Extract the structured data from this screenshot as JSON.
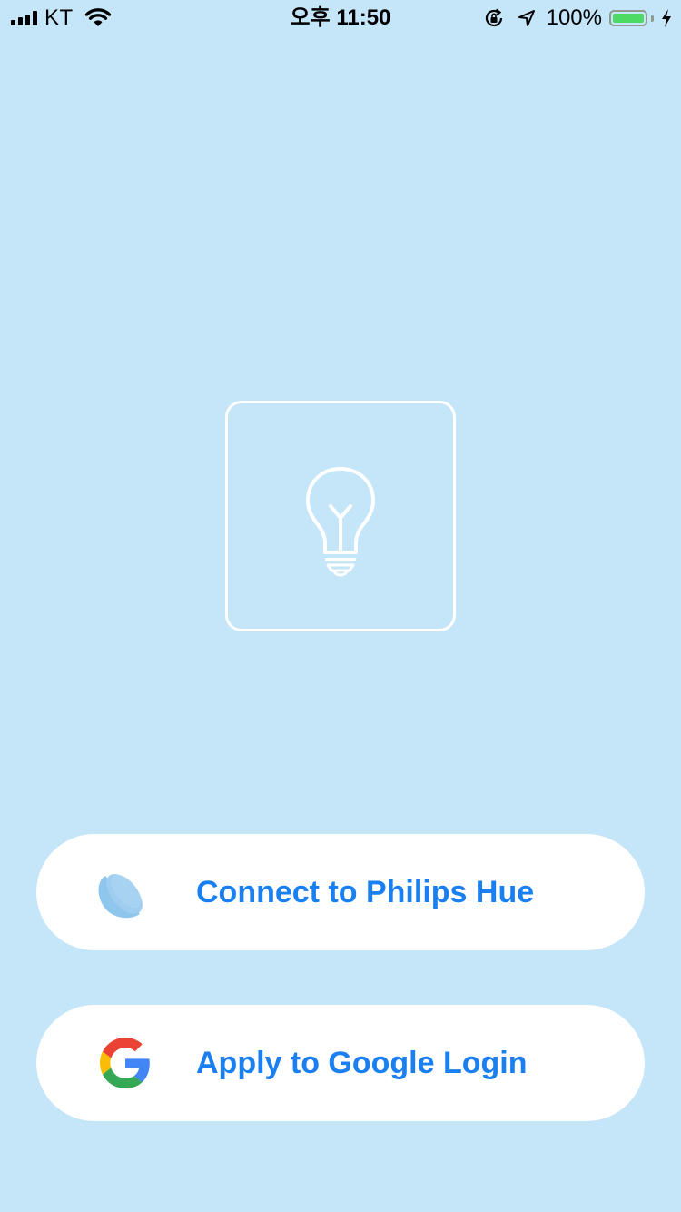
{
  "status_bar": {
    "carrier": "KT",
    "time": "오후 11:50",
    "battery_percent": "100%",
    "battery_level": 1.0,
    "icons": [
      "signal-icon",
      "wifi-icon",
      "orientation-lock-icon",
      "location-icon",
      "battery-icon",
      "charging-icon"
    ]
  },
  "main": {
    "center_icon": "lightbulb-icon"
  },
  "buttons": {
    "hue": {
      "label": "Connect to Philips Hue",
      "icon": "philips-hue-icon"
    },
    "google": {
      "label": "Apply to Google Login",
      "icon": "google-icon"
    }
  },
  "colors": {
    "background": "#c5e5f9",
    "button_background": "#ffffff",
    "button_text": "#1a7ff0",
    "icon_outline": "#ffffff",
    "battery_fill": "#4cd964"
  }
}
